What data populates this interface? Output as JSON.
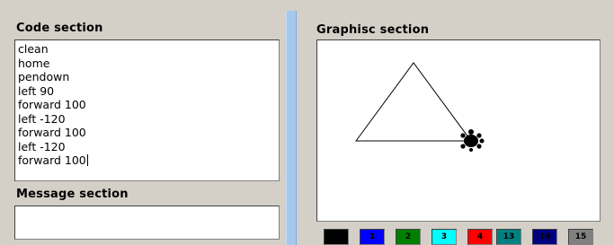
{
  "left": {
    "code_title": "Code section",
    "code_lines": [
      "clean",
      "home",
      "pendown",
      "left 90",
      "forward 100",
      "left -120",
      "forward 100",
      "left -120",
      "forward 100"
    ],
    "message_title": "Message section",
    "message_text": ""
  },
  "right": {
    "graphics_title": "Graphisc section",
    "pen_color": "#000000",
    "turtle_color": "#000000"
  },
  "palette": [
    {
      "label": "",
      "color": "#000000"
    },
    {
      "label": "1",
      "color": "#0000ff"
    },
    {
      "label": "2",
      "color": "#008000"
    },
    {
      "label": "3",
      "color": "#00ffff"
    },
    {
      "label": "4",
      "color": "#ff0000"
    },
    {
      "label": "13",
      "color": "#008080"
    },
    {
      "label": "14",
      "color": "#000080"
    },
    {
      "label": "15",
      "color": "#808080"
    }
  ]
}
